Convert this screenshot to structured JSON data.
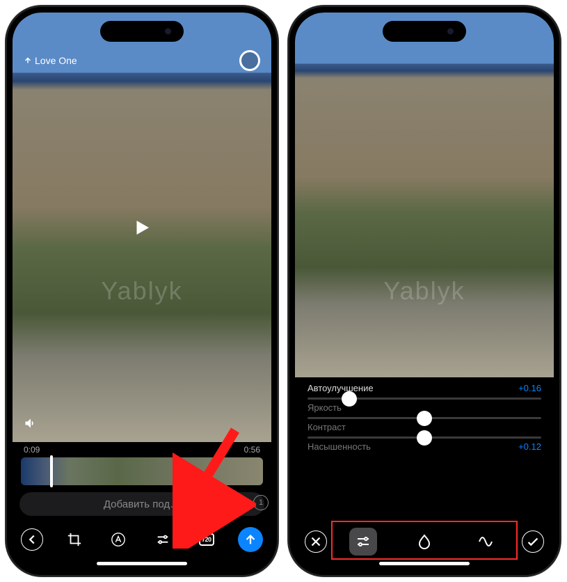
{
  "watermark": "Yablyk",
  "left": {
    "backLabel": "Love One",
    "timeStart": "0:09",
    "timeEnd": "0:56",
    "captionPlaceholder": "Добавить под…",
    "captionBadge": "1",
    "resolution": "720"
  },
  "right": {
    "adjustments": [
      {
        "name": "Автоулучшение",
        "value": "+0.16",
        "pos": 18,
        "dim": false,
        "showSlider": true
      },
      {
        "name": "Яркость",
        "value": "",
        "pos": 50,
        "dim": true,
        "showSlider": true
      },
      {
        "name": "Контраст",
        "value": "",
        "pos": 50,
        "dim": true,
        "showSlider": true
      },
      {
        "name": "Насышенность",
        "value": "+0.12",
        "pos": 50,
        "dim": true,
        "showSlider": false
      }
    ]
  }
}
